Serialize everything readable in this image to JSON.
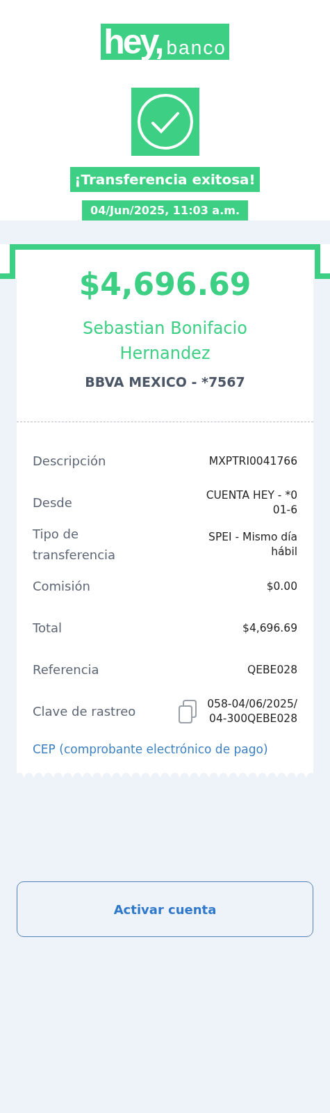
{
  "header": {
    "logo_main": "hey,",
    "logo_sub": "banco",
    "title": "¡Transferencia exitosa!",
    "date": "04/Jun/2025, 11:03 a.m."
  },
  "receipt": {
    "amount": "$4,696.69",
    "recipient": "Sebastian Bonifacio Hernandez",
    "bank": "BBVA MEXICO - *7567",
    "rows": [
      {
        "label": "Descripción",
        "value": "MXPTRI0041766",
        "kind": "plain"
      },
      {
        "label": "Desde",
        "value": "CUENTA HEY - *001-6",
        "kind": "plain"
      },
      {
        "label": "Tipo de transferencia",
        "value": "SPEI - Mismo día hábil",
        "kind": "plain"
      },
      {
        "label": "Comisión",
        "value": "$0.00",
        "kind": "plain"
      },
      {
        "label": "Total",
        "value": "$4,696.69",
        "kind": "plain"
      },
      {
        "label": "Referencia",
        "value": "QEBE028",
        "kind": "plain"
      },
      {
        "label": "Clave de rastreo",
        "value": "058-04/06/2025/04-300QEBE028",
        "kind": "copy"
      }
    ],
    "link": "CEP (comprobante electrónico de pago)"
  },
  "button": "Activar cuenta"
}
